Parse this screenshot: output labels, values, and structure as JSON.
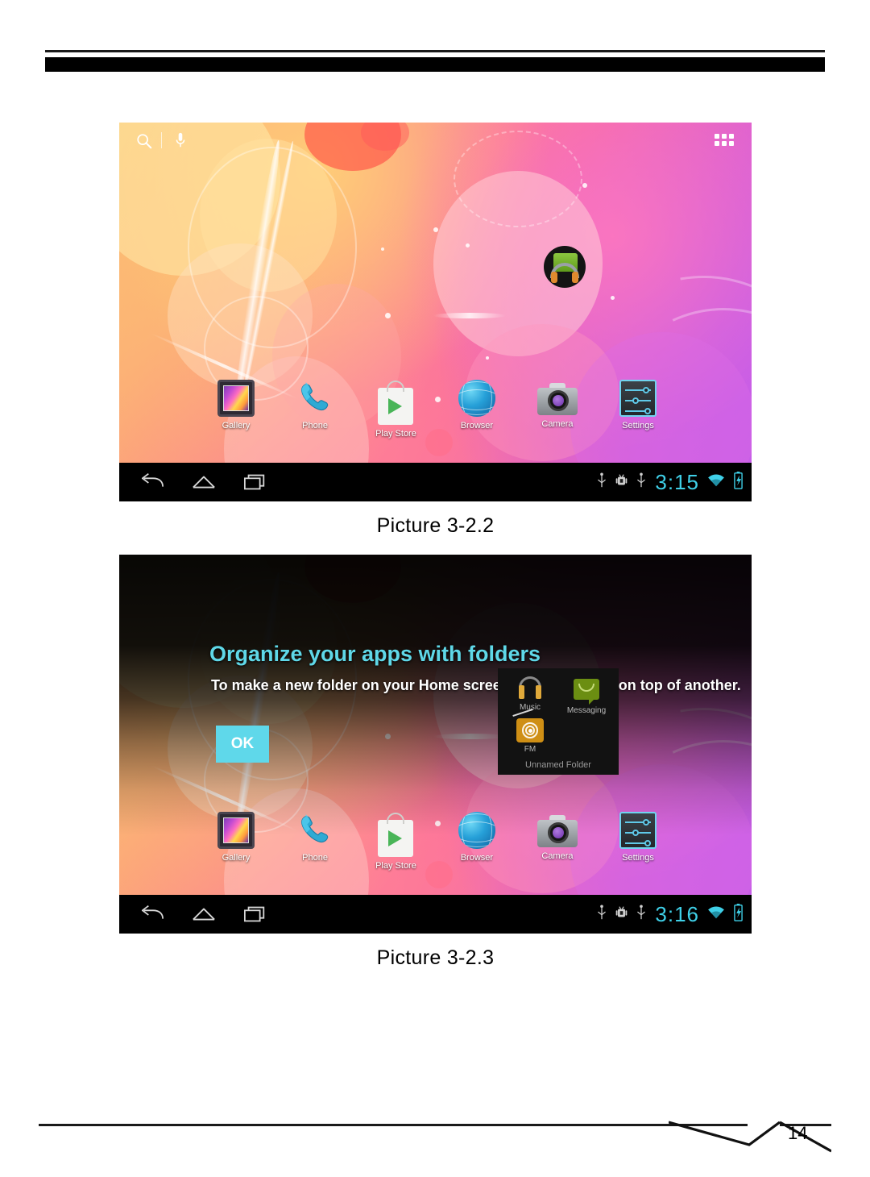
{
  "document": {
    "page_number": "14",
    "figures": [
      {
        "caption": "Picture 3-2.2",
        "screen": {
          "status_time": "3:15",
          "search_icon": "search-icon",
          "mic_icon": "microphone-icon",
          "apps_grid_icon": "apps-grid-icon",
          "nav": {
            "back": "back-icon",
            "home": "home-icon",
            "recents": "recent-apps-icon"
          },
          "status_icons": [
            "usb-icon",
            "android-debug-icon",
            "usb-icon",
            "wifi-icon",
            "battery-charging-icon"
          ],
          "widget": "music-player-widget",
          "dock": [
            {
              "label": "Gallery",
              "icon": "gallery-icon"
            },
            {
              "label": "Phone",
              "icon": "phone-icon"
            },
            {
              "label": "Play Store",
              "icon": "play-store-icon"
            },
            {
              "label": "Browser",
              "icon": "browser-icon"
            },
            {
              "label": "Camera",
              "icon": "camera-icon"
            },
            {
              "label": "Settings",
              "icon": "settings-icon"
            }
          ]
        }
      },
      {
        "caption": "Picture 3-2.3",
        "screen": {
          "status_time": "3:16",
          "tutorial": {
            "title": "Organize your apps with folders",
            "subtitle": "To make a new folder on your Home screen, stack one app on top of another.",
            "ok_label": "OK",
            "title_color": "#5fd8e8",
            "ok_bg": "#5fd8ea"
          },
          "folder": {
            "name": "Unnamed Folder",
            "apps": [
              {
                "label": "Music",
                "icon": "music-icon"
              },
              {
                "label": "Messaging",
                "icon": "messaging-icon"
              },
              {
                "label": "FM",
                "icon": "fm-radio-icon"
              }
            ]
          },
          "nav": {
            "back": "back-icon",
            "home": "home-icon",
            "recents": "recent-apps-icon"
          },
          "status_icons": [
            "usb-icon",
            "android-debug-icon",
            "usb-icon",
            "wifi-icon",
            "battery-charging-icon"
          ],
          "dock": [
            {
              "label": "Gallery",
              "icon": "gallery-icon"
            },
            {
              "label": "Phone",
              "icon": "phone-icon"
            },
            {
              "label": "Play Store",
              "icon": "play-store-icon"
            },
            {
              "label": "Browser",
              "icon": "browser-icon"
            },
            {
              "label": "Camera",
              "icon": "camera-icon"
            },
            {
              "label": "Settings",
              "icon": "settings-icon"
            }
          ]
        }
      }
    ]
  }
}
